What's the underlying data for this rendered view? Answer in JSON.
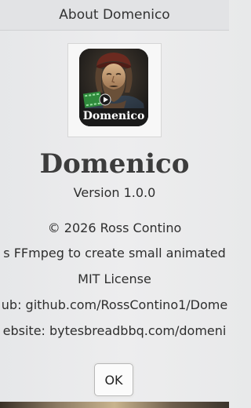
{
  "window": {
    "title": "About Domenico"
  },
  "app": {
    "icon_label": "Domenico",
    "name": "Domenico",
    "version": "Version 1.0.0",
    "copyright": "© 2026 Ross Contino",
    "description": "s FFmpeg to create small animated",
    "license": "MIT License",
    "github": "ub: github.com/RossContino1/Dome",
    "website": "ebsite: bytesbreadbbq.com/domeni"
  },
  "buttons": {
    "ok_label": "OK"
  },
  "colors": {
    "window_bg": "#ececed",
    "titlebar_bg": "#e2e3e5",
    "icon_bg": "#232323",
    "icon_text": "#ffffff"
  }
}
